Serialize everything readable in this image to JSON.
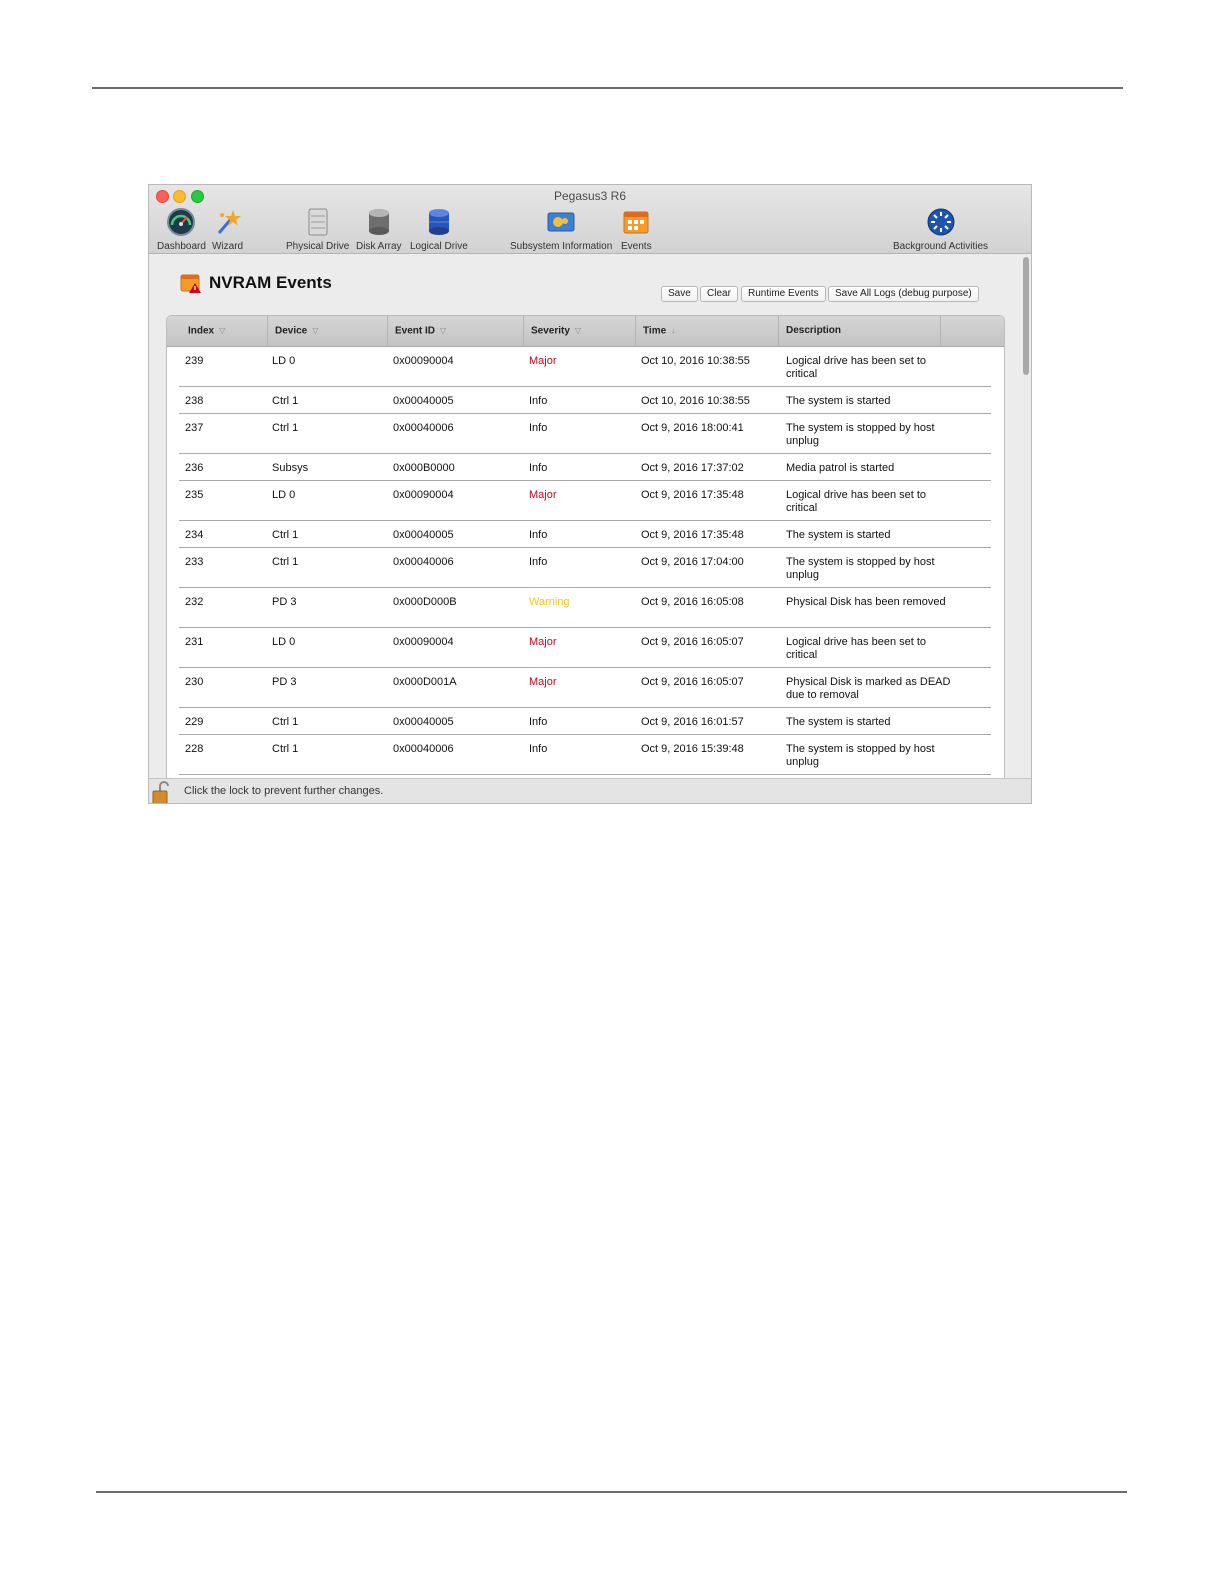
{
  "window": {
    "title": "Pegasus3 R6"
  },
  "toolbar": {
    "dashboard": "Dashboard",
    "wizard": "Wizard",
    "physical_drive": "Physical Drive",
    "disk_array": "Disk Array",
    "logical_drive": "Logical Drive",
    "subsystem_info": "Subsystem Information",
    "events": "Events",
    "background": "Background Activities"
  },
  "panel": {
    "title": "NVRAM Events"
  },
  "buttons": {
    "save": "Save",
    "clear": "Clear",
    "runtime": "Runtime Events",
    "save_all": "Save All Logs (debug purpose)"
  },
  "table": {
    "columns": [
      "Index",
      "Device",
      "Event ID",
      "Severity",
      "Time",
      "Description"
    ],
    "rows": [
      {
        "index": "239",
        "device": "LD 0",
        "event_id": "0x00090004",
        "severity": "Major",
        "time": "Oct 10, 2016 10:38:55",
        "description": "Logical drive has been set to critical"
      },
      {
        "index": "238",
        "device": "Ctrl 1",
        "event_id": "0x00040005",
        "severity": "Info",
        "time": "Oct 10, 2016 10:38:55",
        "description": "The system is started"
      },
      {
        "index": "237",
        "device": "Ctrl 1",
        "event_id": "0x00040006",
        "severity": "Info",
        "time": "Oct 9, 2016 18:00:41",
        "description": "The system is stopped by host unplug"
      },
      {
        "index": "236",
        "device": "Subsys",
        "event_id": "0x000B0000",
        "severity": "Info",
        "time": "Oct 9, 2016 17:37:02",
        "description": "Media patrol is started"
      },
      {
        "index": "235",
        "device": "LD 0",
        "event_id": "0x00090004",
        "severity": "Major",
        "time": "Oct 9, 2016 17:35:48",
        "description": "Logical drive has been set to critical"
      },
      {
        "index": "234",
        "device": "Ctrl 1",
        "event_id": "0x00040005",
        "severity": "Info",
        "time": "Oct 9, 2016 17:35:48",
        "description": "The system is started"
      },
      {
        "index": "233",
        "device": "Ctrl 1",
        "event_id": "0x00040006",
        "severity": "Info",
        "time": "Oct 9, 2016 17:04:00",
        "description": "The system is stopped by host unplug"
      },
      {
        "index": "232",
        "device": "PD 3",
        "event_id": "0x000D000B",
        "severity": "Warning",
        "time": "Oct 9, 2016 16:05:08",
        "description": "Physical Disk has been removed"
      },
      {
        "index": "231",
        "device": "LD 0",
        "event_id": "0x00090004",
        "severity": "Major",
        "time": "Oct 9, 2016 16:05:07",
        "description": "Logical drive has been set to critical"
      },
      {
        "index": "230",
        "device": "PD 3",
        "event_id": "0x000D001A",
        "severity": "Major",
        "time": "Oct 9, 2016 16:05:07",
        "description": "Physical Disk is marked as DEAD due to removal"
      },
      {
        "index": "229",
        "device": "Ctrl 1",
        "event_id": "0x00040005",
        "severity": "Info",
        "time": "Oct 9, 2016 16:01:57",
        "description": "The system is started"
      },
      {
        "index": "228",
        "device": "Ctrl 1",
        "event_id": "0x00040006",
        "severity": "Info",
        "time": "Oct 9, 2016 15:39:48",
        "description": "The system is stopped by host unplug"
      }
    ]
  },
  "severity_colors": {
    "Major": "#d0021b",
    "Warning": "#f5c518",
    "Info": "#111111"
  },
  "status": {
    "text": "Click the lock to prevent further changes."
  }
}
